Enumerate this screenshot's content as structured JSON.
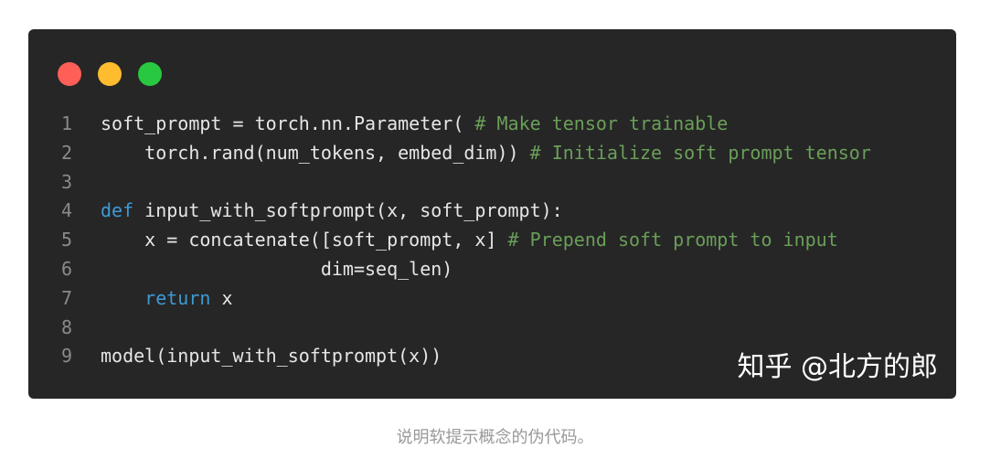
{
  "window": {
    "controls": [
      {
        "name": "close",
        "color": "#ff5f57"
      },
      {
        "name": "minimize",
        "color": "#febc2e"
      },
      {
        "name": "maximize",
        "color": "#28c840"
      }
    ]
  },
  "code": {
    "lines": [
      {
        "number": "1",
        "tokens": [
          {
            "type": "plain",
            "text": "soft_prompt = torch.nn.Parameter( "
          },
          {
            "type": "comment",
            "text": "# Make tensor trainable"
          }
        ]
      },
      {
        "number": "2",
        "tokens": [
          {
            "type": "plain",
            "text": "    torch.rand(num_tokens, embed_dim)) "
          },
          {
            "type": "comment",
            "text": "# Initialize soft prompt tensor"
          }
        ]
      },
      {
        "number": "3",
        "tokens": []
      },
      {
        "number": "4",
        "tokens": [
          {
            "type": "keyword",
            "text": "def"
          },
          {
            "type": "plain",
            "text": " input_with_softprompt(x, soft_prompt):"
          }
        ]
      },
      {
        "number": "5",
        "tokens": [
          {
            "type": "plain",
            "text": "    x = concatenate([soft_prompt, x] "
          },
          {
            "type": "comment",
            "text": "# Prepend soft prompt to input"
          }
        ]
      },
      {
        "number": "6",
        "tokens": [
          {
            "type": "plain",
            "text": "                    dim=seq_len)"
          }
        ]
      },
      {
        "number": "7",
        "tokens": [
          {
            "type": "plain",
            "text": "    "
          },
          {
            "type": "keyword",
            "text": "return"
          },
          {
            "type": "plain",
            "text": " x"
          }
        ]
      },
      {
        "number": "8",
        "tokens": []
      },
      {
        "number": "9",
        "tokens": [
          {
            "type": "plain",
            "text": "model(input_with_softprompt(x))"
          }
        ]
      }
    ]
  },
  "watermark": "知乎 @北方的郎",
  "caption": "说明软提示概念的伪代码。"
}
